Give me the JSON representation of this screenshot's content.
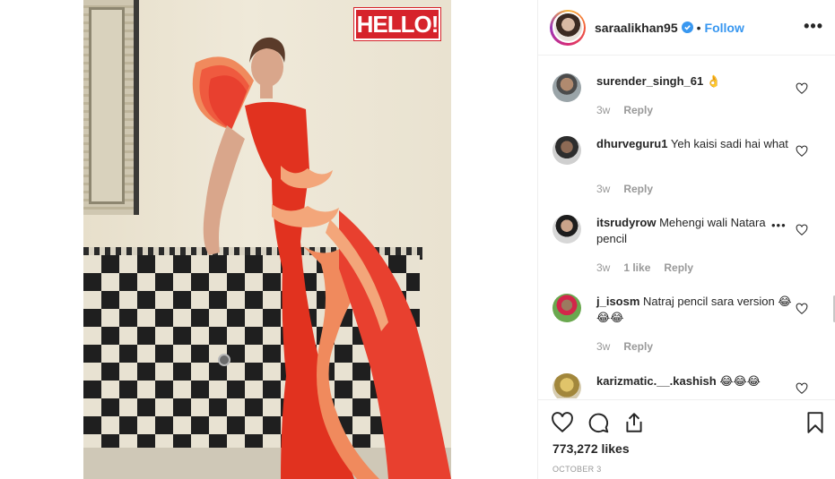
{
  "colors": {
    "link": "#3897f0",
    "text": "#262626",
    "meta": "#999999",
    "logo_bg": "#d6232b"
  },
  "photo": {
    "logo_text": "HELLO!"
  },
  "header": {
    "username": "saraalikhan95",
    "verified_icon": "verified-badge-icon",
    "separator": "•",
    "follow_label": "Follow",
    "more_label": "•••"
  },
  "comments": [
    {
      "username": "surender_singh_61",
      "text": "👌",
      "age": "3w",
      "reply_label": "Reply"
    },
    {
      "username": "dhurveguru1",
      "text": "Yeh kaisi sadi hai what",
      "age": "3w",
      "reply_label": "Reply"
    },
    {
      "username": "itsrudyrow",
      "text": "Mehengi wali Natara pencil",
      "more_label": "•••",
      "age": "3w",
      "likes": "1 like",
      "reply_label": "Reply"
    },
    {
      "username": "j_isosm",
      "text": "Natraj pencil sara version 😂😂😂",
      "age": "3w",
      "reply_label": "Reply"
    },
    {
      "username": "karizmatic.__.kashish",
      "text": "😂😂😂"
    }
  ],
  "footer": {
    "icons": [
      "heart-icon",
      "comment-icon",
      "share-icon",
      "bookmark-icon"
    ],
    "likes": "773,272 likes",
    "date": "OCTOBER 3"
  }
}
